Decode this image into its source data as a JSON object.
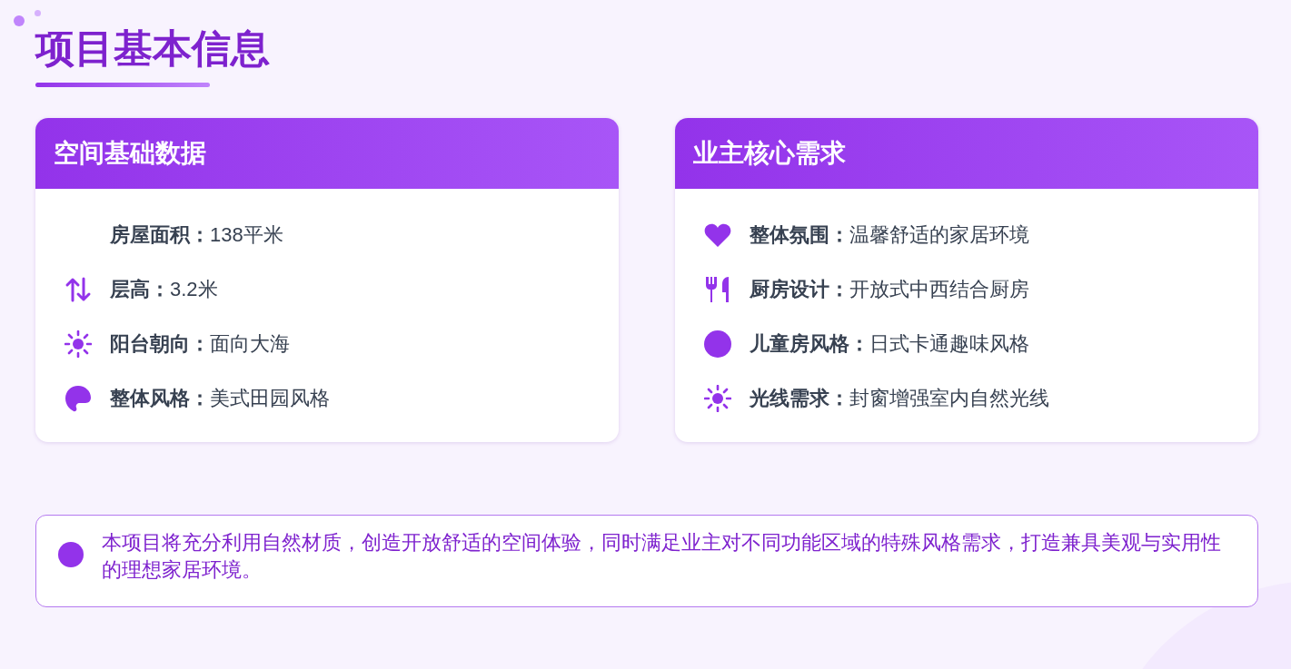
{
  "title": "项目基本信息",
  "cards": [
    {
      "heading": "空间基础数据",
      "items": [
        {
          "kind": "none",
          "label": "房屋面积：",
          "value": "138平米"
        },
        {
          "kind": "arrows",
          "label": "层高：",
          "value": "3.2米"
        },
        {
          "kind": "sun",
          "label": "阳台朝向：",
          "value": "面向大海"
        },
        {
          "kind": "palette",
          "label": "整体风格：",
          "value": "美式田园风格"
        }
      ]
    },
    {
      "heading": "业主核心需求",
      "items": [
        {
          "kind": "heart",
          "label": "整体氛围：",
          "value": "温馨舒适的家居环境"
        },
        {
          "kind": "utensils",
          "label": "厨房设计：",
          "value": "开放式中西结合厨房"
        },
        {
          "kind": "circle",
          "label": "儿童房风格：",
          "value": "日式卡通趣味风格"
        },
        {
          "kind": "sun",
          "label": "光线需求：",
          "value": "封窗增强室内自然光线"
        }
      ]
    }
  ],
  "summary": {
    "text": "本项目将充分利用自然材质，创造开放舒适的空间体验，同时满足业主对不同功能区域的特殊风格需求，打造兼具美观与实用性的理想家居环境。"
  }
}
